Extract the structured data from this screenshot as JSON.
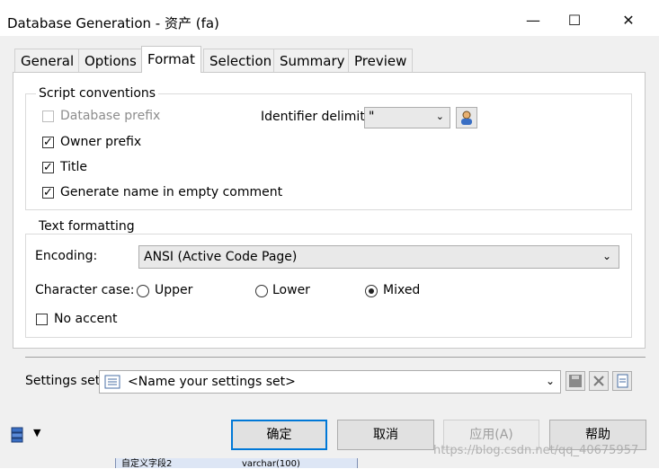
{
  "window": {
    "title": "Database Generation - 资产 (fa)",
    "controls": {
      "minimize": "—",
      "maximize": "☐",
      "close": "✕"
    }
  },
  "tabs": [
    {
      "label": "General",
      "active": false
    },
    {
      "label": "Options",
      "active": false
    },
    {
      "label": "Format",
      "active": true
    },
    {
      "label": "Selection",
      "active": false
    },
    {
      "label": "Summary",
      "active": false
    },
    {
      "label": "Preview",
      "active": false
    }
  ],
  "script_conventions": {
    "title": "Script conventions",
    "database_prefix": {
      "label": "Database prefix",
      "checked": false,
      "enabled": false
    },
    "owner_prefix": {
      "label": "Owner prefix",
      "checked": true
    },
    "title_opt": {
      "label": "Title",
      "checked": true
    },
    "generate_name": {
      "label": "Generate name in empty comment",
      "checked": true
    },
    "identifier_delimiter": {
      "label": "Identifier delimiter:",
      "value": "\""
    }
  },
  "text_formatting": {
    "title": "Text formatting",
    "encoding": {
      "label": "Encoding:",
      "value": "ANSI (Active Code Page)"
    },
    "character_case": {
      "label": "Character case:",
      "options": [
        {
          "label": "Upper",
          "selected": false
        },
        {
          "label": "Lower",
          "selected": false
        },
        {
          "label": "Mixed",
          "selected": true
        }
      ]
    },
    "no_accent": {
      "label": "No accent",
      "checked": false
    }
  },
  "settings_set": {
    "label": "Settings set:",
    "value": "<Name your settings set>"
  },
  "buttons": {
    "ok": "确定",
    "cancel": "取消",
    "apply": "应用(A)",
    "help": "帮助"
  },
  "background_text": {
    "row": "自定义字段2",
    "type": "varchar(100)"
  },
  "watermark": "https://blog.csdn.net/qq_40675957"
}
